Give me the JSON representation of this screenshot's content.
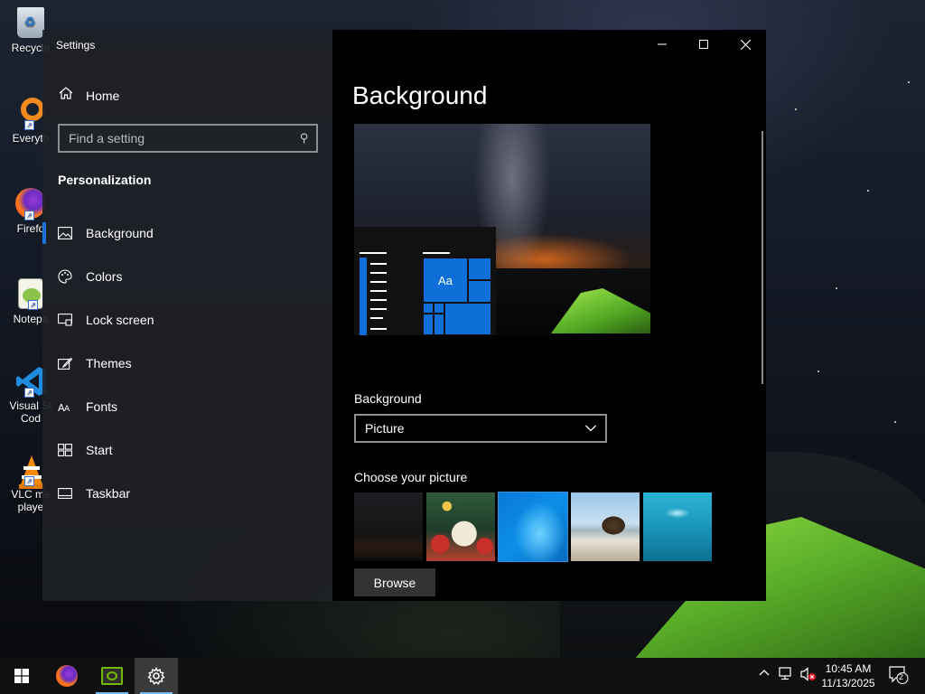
{
  "desktop": {
    "icons": [
      {
        "label": "Recycle",
        "icon": "recycle-bin-icon"
      },
      {
        "label": "Everyth",
        "icon": "everything-search-icon"
      },
      {
        "label": "Firefo",
        "icon": "firefox-icon"
      },
      {
        "label": "Notepa",
        "icon": "notepad-plus-plus-icon"
      },
      {
        "label": "Visual St",
        "label2": "Cod",
        "icon": "vscode-icon"
      },
      {
        "label": "VLC me",
        "label2": "playe",
        "icon": "vlc-icon"
      }
    ]
  },
  "window": {
    "app_title": "Settings",
    "controls": {
      "minimize": "—",
      "maximize": "☐",
      "close": "✕"
    }
  },
  "nav": {
    "home_label": "Home",
    "search_placeholder": "Find a setting",
    "section_title": "Personalization",
    "items": [
      {
        "label": "Background",
        "icon": "picture-icon",
        "active": true
      },
      {
        "label": "Colors",
        "icon": "palette-icon",
        "active": false
      },
      {
        "label": "Lock screen",
        "icon": "lock-screen-icon",
        "active": false
      },
      {
        "label": "Themes",
        "icon": "themes-brush-icon",
        "active": false
      },
      {
        "label": "Fonts",
        "icon": "fonts-icon",
        "active": false
      },
      {
        "label": "Start",
        "icon": "start-menu-icon",
        "active": false
      },
      {
        "label": "Taskbar",
        "icon": "taskbar-icon",
        "active": false
      }
    ]
  },
  "content": {
    "page_title": "Background",
    "preview": {
      "tile_label": "Aa"
    },
    "background_label": "Background",
    "background_value": "Picture",
    "choose_label": "Choose your picture",
    "browse_label": "Browse"
  },
  "taskbar": {
    "time": "10:45 AM",
    "date": "11/13/2025",
    "notification_count": "2",
    "accent_color": "#1a73d9"
  }
}
